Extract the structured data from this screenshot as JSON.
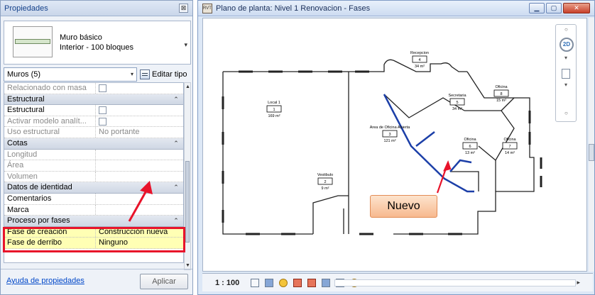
{
  "properties_panel": {
    "title": "Propiedades",
    "close_glyph": "⊠",
    "type_selector": {
      "family": "Muro básico",
      "type": "Interior - 100 bloques",
      "arrow": "▾"
    },
    "filter": {
      "value": "Muros (5)",
      "arrow": "▾",
      "edit_type_label": "Editar tipo"
    },
    "rows": [
      {
        "kind": "param",
        "label": "Relacionado con masa",
        "value": "",
        "checkbox": true,
        "grey": true
      },
      {
        "kind": "group",
        "label": "Estructural",
        "chevron": "⌃"
      },
      {
        "kind": "param",
        "label": "Estructural",
        "value": "",
        "checkbox": true
      },
      {
        "kind": "param",
        "label": "Activar modelo analít...",
        "value": "",
        "checkbox": true,
        "grey": true
      },
      {
        "kind": "param",
        "label": "Uso estructural",
        "value": "No portante",
        "grey": true
      },
      {
        "kind": "group",
        "label": "Cotas",
        "chevron": "⌃"
      },
      {
        "kind": "param",
        "label": "Longitud",
        "value": "",
        "grey": true
      },
      {
        "kind": "param",
        "label": "Área",
        "value": "",
        "grey": true
      },
      {
        "kind": "param",
        "label": "Volumen",
        "value": "",
        "grey": true
      },
      {
        "kind": "group",
        "label": "Datos de identidad",
        "chevron": "⌃"
      },
      {
        "kind": "param",
        "label": "Comentarios",
        "value": ""
      },
      {
        "kind": "param",
        "label": "Marca",
        "value": ""
      },
      {
        "kind": "group",
        "label": "Proceso por fases",
        "chevron": "⌃"
      },
      {
        "kind": "param",
        "label": "Fase de creación",
        "value": "Construcción nueva",
        "highlight": true
      },
      {
        "kind": "param",
        "label": "Fase de derribo",
        "value": "Ninguno",
        "highlight": true
      }
    ],
    "help_link": "Ayuda de propiedades",
    "apply_button": "Aplicar"
  },
  "view_window": {
    "title": "Plano de planta: Nivel 1 Renovacion - Fases",
    "app_icon_text": "RVT",
    "window_buttons": {
      "minimize": "▁",
      "maximize": "▢",
      "close": "✕"
    },
    "navbar": {
      "label_2d": "2D"
    },
    "scale": "1 : 100",
    "scroll_left": "◂",
    "scroll_right": "▸",
    "rooms": [
      {
        "name": "Local 1",
        "number": "1",
        "area": "169 m²"
      },
      {
        "name": "Recepcion",
        "number": "4",
        "area": "34 m²"
      },
      {
        "name": "Secretaria",
        "number": "5",
        "area": "34 m²"
      },
      {
        "name": "Oficina",
        "number": "8",
        "area": "15 m²"
      },
      {
        "name": "Area de Oficina Abierta",
        "number": "3",
        "area": "121 m²"
      },
      {
        "name": "Oficina",
        "number": "6",
        "area": "13 m²"
      },
      {
        "name": "Oficina",
        "number": "7",
        "area": "14 m²"
      },
      {
        "name": "Vestibulo",
        "number": "2",
        "area": "9 m²"
      }
    ],
    "callout": "Nuevo"
  },
  "colors": {
    "highlight_border": "#e8132a",
    "highlight_fill": "#ffffb4",
    "new_wall": "#1c3fa8",
    "callout_fill": "#f7b98f"
  }
}
